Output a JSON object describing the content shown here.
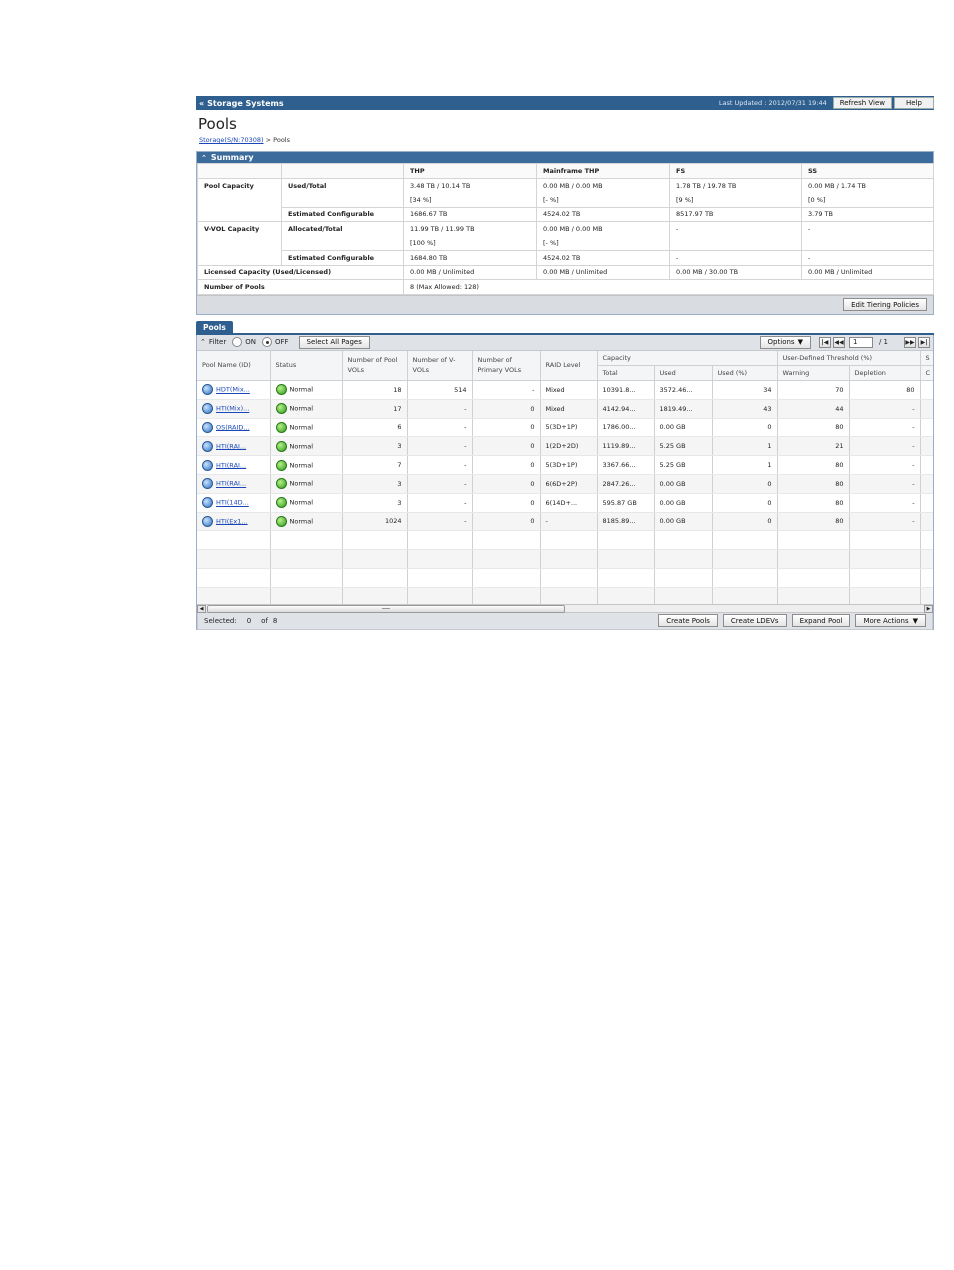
{
  "header": {
    "title": "Storage Systems",
    "last_updated": "Last Updated : 2012/07/31 19:44",
    "refresh_label": "Refresh View",
    "help_label": "Help"
  },
  "page": {
    "title": "Pools",
    "breadcrumb_link": "Storage(S/N:70308)",
    "breadcrumb_sep": " > ",
    "breadcrumb_current": "Pools"
  },
  "summary": {
    "title": "Summary",
    "columns": [
      "THP",
      "Mainframe THP",
      "FS",
      "SS"
    ],
    "pool_capacity_label": "Pool Capacity",
    "used_total_label": "Used/Total",
    "used_total": [
      "3.48 TB / 10.14 TB",
      "0.00 MB / 0.00 MB",
      "1.78 TB / 19.78 TB",
      "0.00 MB / 1.74 TB"
    ],
    "used_total_pct": [
      "[34 %]",
      "[- %]",
      "[9 %]",
      "[0 %]"
    ],
    "est_config_label": "Estimated Configurable",
    "pool_est_config": [
      "1686.67 TB",
      "4524.02 TB",
      "8517.97 TB",
      "3.79 TB"
    ],
    "vvol_capacity_label": "V-VOL Capacity",
    "alloc_total_label": "Allocated/Total",
    "alloc_total": [
      "11.99 TB / 11.99 TB",
      "0.00 MB / 0.00 MB",
      "-",
      "-"
    ],
    "alloc_total_pct": [
      "[100 %]",
      "[- %]",
      "",
      ""
    ],
    "vvol_est_config": [
      "1684.80 TB",
      "4524.02 TB",
      "-",
      "-"
    ],
    "licensed_label": "Licensed Capacity (Used/Licensed)",
    "licensed": [
      "0.00 MB / Unlimited",
      "0.00 MB / Unlimited",
      "0.00 MB / 30.00 TB",
      "0.00 MB / Unlimited"
    ],
    "num_pools_label": "Number of Pools",
    "num_pools": "8 (Max Allowed: 128)",
    "edit_button": "Edit Tiering Policies"
  },
  "pools_panel": {
    "tab_label": "Pools",
    "filter_label": "Filter",
    "on_label": "ON",
    "off_label": "OFF",
    "select_all_label": "Select All Pages",
    "options_label": "Options",
    "page_current": "1",
    "page_total": "/ 1",
    "headers": {
      "pool_name": "Pool Name (ID)",
      "status": "Status",
      "pool_vols": "Number of Pool VOLs",
      "vvols": "Number of V-VOLs",
      "primary_vols": "Number of Primary VOLs",
      "raid": "RAID Level",
      "capacity": "Capacity",
      "total": "Total",
      "used": "Used",
      "used_pct": "Used (%)",
      "threshold": "User-Defined Threshold (%)",
      "warning": "Warning",
      "depletion": "Depletion",
      "extra_top": "S",
      "extra_bottom": "C"
    },
    "rows": [
      {
        "name": "HDT(Mix...",
        "status": "Normal",
        "pool_vols": "18",
        "vvols": "514",
        "primary": "-",
        "raid": "Mixed",
        "total": "10391.8...",
        "used": "3572.46...",
        "used_pct": "34",
        "warning": "70",
        "depletion": "80"
      },
      {
        "name": "HTI(Mix)...",
        "status": "Normal",
        "pool_vols": "17",
        "vvols": "-",
        "primary": "0",
        "raid": "Mixed",
        "total": "4142.94...",
        "used": "1819.49...",
        "used_pct": "43",
        "warning": "44",
        "depletion": "-"
      },
      {
        "name": "OS(RAID...",
        "status": "Normal",
        "pool_vols": "6",
        "vvols": "-",
        "primary": "0",
        "raid": "5(3D+1P)",
        "total": "1786.00...",
        "used": "0.00 GB",
        "used_pct": "0",
        "warning": "80",
        "depletion": "-"
      },
      {
        "name": "HTI(RAI...",
        "status": "Normal",
        "pool_vols": "3",
        "vvols": "-",
        "primary": "0",
        "raid": "1(2D+2D)",
        "total": "1119.89...",
        "used": "5.25 GB",
        "used_pct": "1",
        "warning": "21",
        "depletion": "-"
      },
      {
        "name": "HTI(RAI...",
        "status": "Normal",
        "pool_vols": "7",
        "vvols": "-",
        "primary": "0",
        "raid": "5(3D+1P)",
        "total": "3367.66...",
        "used": "5.25 GB",
        "used_pct": "1",
        "warning": "80",
        "depletion": "-"
      },
      {
        "name": "HTI(RAI...",
        "status": "Normal",
        "pool_vols": "3",
        "vvols": "-",
        "primary": "0",
        "raid": "6(6D+2P)",
        "total": "2847.26...",
        "used": "0.00 GB",
        "used_pct": "0",
        "warning": "80",
        "depletion": "-"
      },
      {
        "name": "HTI(14D...",
        "status": "Normal",
        "pool_vols": "3",
        "vvols": "-",
        "primary": "0",
        "raid": "6(14D+...",
        "total": "595.87 GB",
        "used": "0.00 GB",
        "used_pct": "0",
        "warning": "80",
        "depletion": "-"
      },
      {
        "name": "HTI(Ex1...",
        "status": "Normal",
        "pool_vols": "1024",
        "vvols": "-",
        "primary": "0",
        "raid": "-",
        "total": "8185.89...",
        "used": "0.00 GB",
        "used_pct": "0",
        "warning": "80",
        "depletion": "-"
      }
    ],
    "empty_rows": 4,
    "selected_label": "Selected:",
    "selected_count": "0",
    "of_label": "of",
    "of_count": "8",
    "actions": [
      "Create Pools",
      "Create LDEVs",
      "Expand Pool",
      "More Actions"
    ]
  }
}
